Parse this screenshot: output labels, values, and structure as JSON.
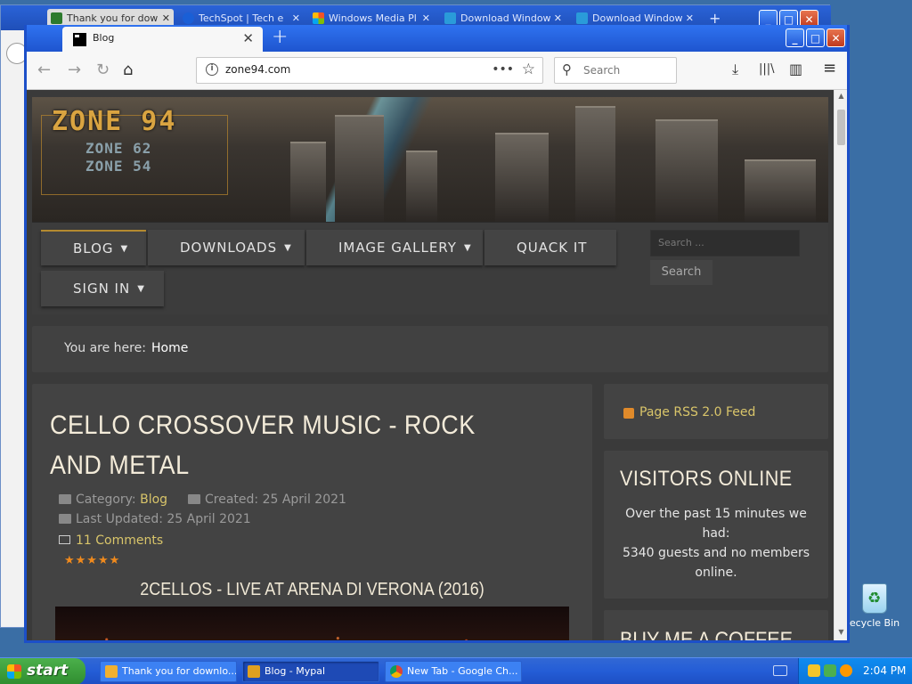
{
  "background_window": {
    "tabs": [
      {
        "label": "Thank you for dow",
        "color": "#2d7a2d"
      },
      {
        "label": "TechSpot | Tech e",
        "color": "#1a5fd6"
      },
      {
        "label": "Windows Media Pl",
        "color": "#e64a19"
      },
      {
        "label": "Download Window",
        "color": "#2a9bd9"
      },
      {
        "label": "Download Window",
        "color": "#2a9bd9"
      }
    ],
    "new_tab": "+",
    "win_buttons": {
      "minimize": "_",
      "maximize": "□",
      "close": "✕"
    }
  },
  "browser": {
    "tab": {
      "title": "Blog",
      "close": "✕"
    },
    "new_tab": "+",
    "win_buttons": {
      "minimize": "_",
      "maximize": "□",
      "close": "✕"
    },
    "nav": {
      "back": "←",
      "forward": "→",
      "reload": "↻",
      "home": "⌂"
    },
    "url": "zone94.com",
    "url_menu": "•••",
    "bookmark": "☆",
    "search_placeholder": "Search",
    "tools": {
      "download": "⤓",
      "library": "|||\\",
      "sidebar": "▥",
      "menu": "≡"
    }
  },
  "site": {
    "logo": {
      "main": "ZONE 94",
      "sub1": "ZONE 62",
      "sub2": "ZONE 54"
    },
    "menu": [
      {
        "label": "BLOG",
        "caret": "▼"
      },
      {
        "label": "DOWNLOADS",
        "caret": "▼"
      },
      {
        "label": "IMAGE GALLERY",
        "caret": "▼"
      },
      {
        "label": "QUACK IT",
        "caret": ""
      },
      {
        "label": "SIGN IN",
        "caret": "▼"
      }
    ],
    "search_placeholder": "Search ...",
    "search_button": "Search",
    "breadcrumb": {
      "label": "You are here:",
      "current": "Home"
    },
    "article": {
      "title": "CELLO CROSSOVER MUSIC - ROCK AND METAL",
      "category_label": "Category:",
      "category": "Blog",
      "created": "Created: 25 April 2021",
      "updated": "Last Updated: 25 April 2021",
      "comments": "11 Comments",
      "rating_stars": "★★★★★",
      "video_title": "2CELLOS - LIVE AT ARENA DI VERONA (2016)"
    },
    "sidebar": {
      "rss": "Page RSS 2.0 Feed",
      "visitors_title": "VISITORS ONLINE",
      "visitors_text1": "Over the past 15 minutes we had:",
      "visitors_text2": "5340 guests and no members online.",
      "coffee_title": "BUY ME A COFFEE"
    }
  },
  "desktop": {
    "recycle_bin": "ecycle Bin"
  },
  "taskbar": {
    "start": "start",
    "tasks": [
      {
        "label": "Thank you for downlo...",
        "color": "#f0b030"
      },
      {
        "label": "Blog - Mypal",
        "color": "#e0a020"
      },
      {
        "label": "New Tab - Google Ch...",
        "color": "#2aa84a"
      }
    ],
    "clock": "2:04 PM"
  }
}
